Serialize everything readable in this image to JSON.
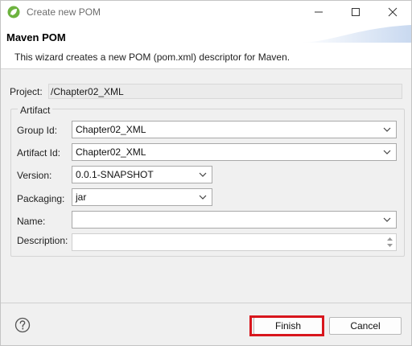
{
  "window": {
    "title": "Create new POM"
  },
  "titlebar_buttons": {
    "minimize": "—",
    "maximize": "☐",
    "close": "✕"
  },
  "header": {
    "title": "Maven POM",
    "description": "This wizard creates a new POM (pom.xml) descriptor for Maven."
  },
  "project": {
    "label": "Project:",
    "value": "/Chapter02_XML"
  },
  "artifact": {
    "legend": "Artifact",
    "group_id": {
      "label": "Group Id:",
      "value": "Chapter02_XML"
    },
    "artifact_id": {
      "label": "Artifact Id:",
      "value": "Chapter02_XML"
    },
    "version": {
      "label": "Version:",
      "value": "0.0.1-SNAPSHOT"
    },
    "packaging": {
      "label": "Packaging:",
      "value": "jar"
    },
    "name": {
      "label": "Name:",
      "value": ""
    },
    "description": {
      "label": "Description:",
      "value": ""
    }
  },
  "footer": {
    "finish_label": "Finish",
    "cancel_label": "Cancel",
    "help_icon": "question-circle-icon"
  },
  "colors": {
    "highlight": "#d8161d",
    "app_icon": "#6db33f"
  }
}
